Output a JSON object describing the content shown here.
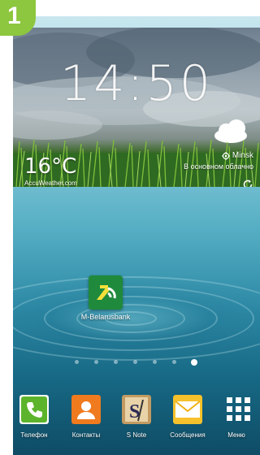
{
  "badge": {
    "number": "1",
    "color": "#8dc63f"
  },
  "weather_widget": {
    "time": "14:50",
    "temperature": "16°C",
    "provider": "AccuWeather.com",
    "location": "Minsk",
    "condition": "В основном облачно",
    "icons": [
      "location-pin-icon",
      "refresh-icon"
    ]
  },
  "home_screen": {
    "apps": [
      {
        "label": "M-Belarusbank",
        "icon": "m-belarusbank-icon",
        "color": "#1f8a3c"
      }
    ],
    "pager": {
      "pages": 7,
      "current": 7
    }
  },
  "dock": {
    "items": [
      {
        "label": "Телефон",
        "icon": "phone-icon"
      },
      {
        "label": "Контакты",
        "icon": "contacts-icon"
      },
      {
        "label": "S Note",
        "icon": "s-note-icon"
      },
      {
        "label": "Сообщения",
        "icon": "messages-icon"
      },
      {
        "label": "Меню",
        "icon": "apps-menu-icon"
      }
    ]
  }
}
